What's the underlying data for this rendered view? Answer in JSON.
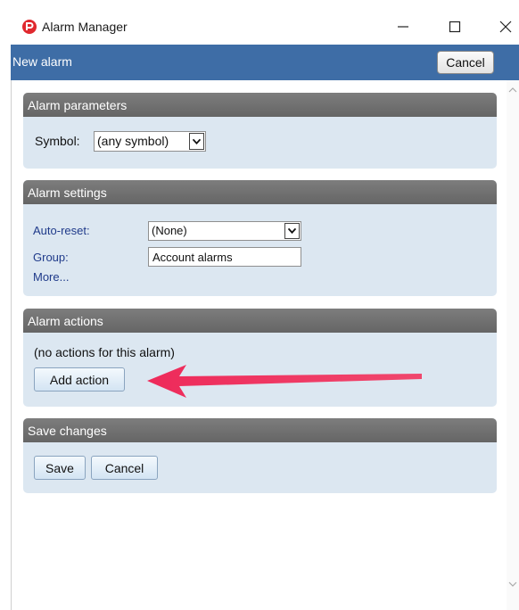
{
  "window": {
    "title": "Alarm Manager",
    "controls": [
      "minimize",
      "maximize",
      "close"
    ]
  },
  "header": {
    "title": "New alarm",
    "cancel_label": "Cancel",
    "bg_color": "#3e6da6"
  },
  "alarm_parameters": {
    "title": "Alarm parameters",
    "symbol_label": "Symbol:",
    "symbol_value": "(any symbol)"
  },
  "alarm_settings": {
    "title": "Alarm settings",
    "auto_reset_label": "Auto-reset:",
    "auto_reset_value": "(None)",
    "group_label": "Group:",
    "group_value": "Account alarms",
    "more_link": "More..."
  },
  "alarm_actions": {
    "title": "Alarm actions",
    "empty_text": "(no actions for this alarm)",
    "add_action_label": "Add action"
  },
  "save_changes": {
    "title": "Save changes",
    "save_label": "Save",
    "cancel_label": "Cancel"
  },
  "annotation": {
    "arrow_color": "#ee2a5a"
  }
}
